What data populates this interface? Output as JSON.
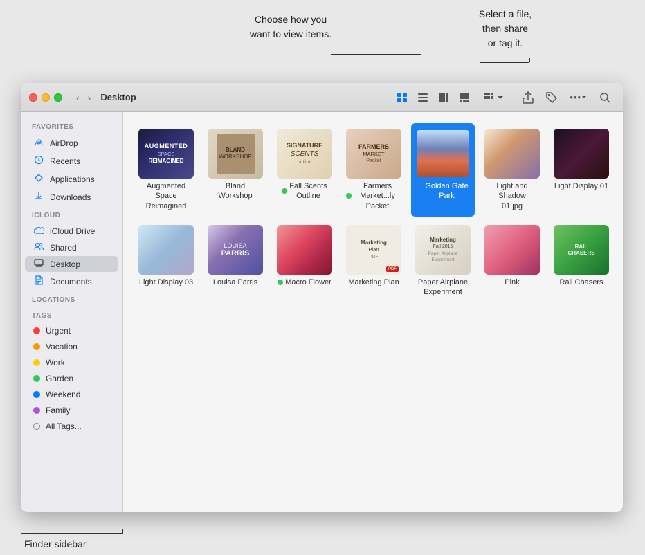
{
  "callouts": {
    "view_title": "Choose how you\nwant to view items.",
    "share_title": "Select a file,\nthen share\nor tag it.",
    "sidebar_label": "Finder sidebar"
  },
  "window": {
    "title": "Desktop"
  },
  "toolbar": {
    "back": "‹",
    "forward": "›",
    "view_icon": "⊞",
    "list_icon": "≡",
    "column_icon": "⊟",
    "gallery_icon": "⊡",
    "group_label": "⊞",
    "share_icon": "↑",
    "tag_icon": "◈",
    "more_icon": "···",
    "search_icon": "🔍"
  },
  "sidebar": {
    "favorites_label": "Favorites",
    "icloud_label": "iCloud",
    "locations_label": "Locations",
    "tags_label": "Tags",
    "items": [
      {
        "id": "airdrop",
        "label": "AirDrop",
        "icon": "📡"
      },
      {
        "id": "recents",
        "label": "Recents",
        "icon": "🕐"
      },
      {
        "id": "applications",
        "label": "Applications",
        "icon": "🚀"
      },
      {
        "id": "downloads",
        "label": "Downloads",
        "icon": "⬇"
      },
      {
        "id": "icloud-drive",
        "label": "iCloud Drive",
        "icon": "☁"
      },
      {
        "id": "shared",
        "label": "Shared",
        "icon": "👥"
      },
      {
        "id": "desktop",
        "label": "Desktop",
        "icon": "🖥",
        "active": true
      },
      {
        "id": "documents",
        "label": "Documents",
        "icon": "📄"
      }
    ],
    "tags": [
      {
        "id": "urgent",
        "label": "Urgent",
        "color": "#ff3b30"
      },
      {
        "id": "vacation",
        "label": "Vacation",
        "color": "#ff9500"
      },
      {
        "id": "work",
        "label": "Work",
        "color": "#ffcc00"
      },
      {
        "id": "garden",
        "label": "Garden",
        "color": "#34c759"
      },
      {
        "id": "weekend",
        "label": "Weekend",
        "color": "#007aff"
      },
      {
        "id": "family",
        "label": "Family",
        "color": "#af52de"
      },
      {
        "id": "all-tags",
        "label": "All Tags...",
        "color": null
      }
    ]
  },
  "files": {
    "row1": [
      {
        "id": "augmented-space",
        "name": "Augmented\nSpace Reimagined",
        "thumb": "augmented",
        "dot": null,
        "selected": false
      },
      {
        "id": "bland-workshop",
        "name": "Bland Workshop",
        "thumb": "bland",
        "dot": null,
        "selected": false
      },
      {
        "id": "fall-scents",
        "name": "Fall Scents\nOutline",
        "thumb": "fall",
        "dot": "green",
        "selected": false
      },
      {
        "id": "farmers-market",
        "name": "Farmers\nMarket...ly Packet",
        "thumb": "farmers",
        "dot": "green",
        "selected": false
      },
      {
        "id": "golden-gate",
        "name": "Golden Gate\nPark",
        "thumb": "golden",
        "dot": "blue",
        "selected": true
      },
      {
        "id": "light-shadow",
        "name": "Light and Shadow\n01.jpg",
        "thumb": "light-shadow",
        "dot": null,
        "selected": false
      },
      {
        "id": "light-display-01",
        "name": "Light Display 01",
        "thumb": "light-display-01",
        "dot": null,
        "selected": false
      }
    ],
    "row2": [
      {
        "id": "light-display-03",
        "name": "Light Display 03",
        "thumb": "light-display-03",
        "dot": null,
        "selected": false
      },
      {
        "id": "louisa-parris",
        "name": "Louisa Parris",
        "thumb": "louisa",
        "dot": null,
        "selected": false
      },
      {
        "id": "macro-flower",
        "name": "Macro Flower",
        "thumb": "macro",
        "dot": "green",
        "selected": false
      },
      {
        "id": "marketing-plan",
        "name": "Marketing Plan",
        "thumb": "marketing",
        "dot": null,
        "selected": false
      },
      {
        "id": "paper-airplane",
        "name": "Paper Airplane\nExperiment",
        "thumb": "paper",
        "dot": null,
        "selected": false
      },
      {
        "id": "pink",
        "name": "Pink",
        "thumb": "pink",
        "dot": null,
        "selected": false
      },
      {
        "id": "rail-chasers",
        "name": "Rail Chasers",
        "thumb": "rail",
        "dot": null,
        "selected": false
      }
    ]
  }
}
